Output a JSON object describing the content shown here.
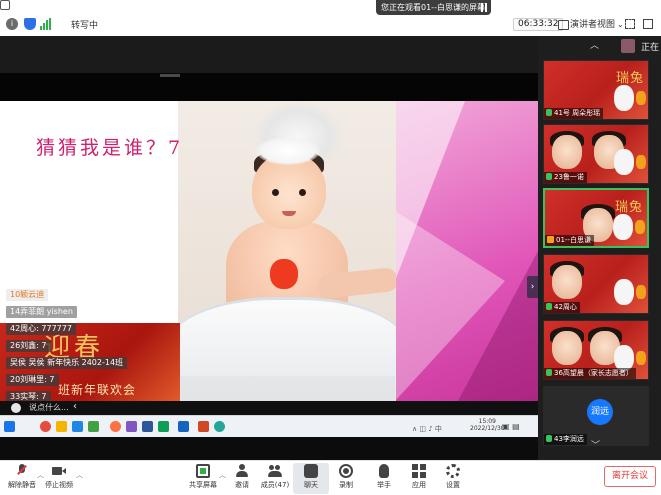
{
  "top_bar": {
    "share_notice": "您正在观看01--白思谦的屏幕",
    "transcribe_label": "转写中",
    "timer": "06:33:32",
    "speaker_view_label": "演讲者视图"
  },
  "slide": {
    "title": "猜猜我是谁？7",
    "banner_big": "迎春",
    "banner_sub": "班新年联欢会"
  },
  "comments": [
    {
      "text": "10颖云迪",
      "style": "lite"
    },
    {
      "text": "14弄菲朗 yishen",
      "style": "gray"
    },
    {
      "text": "42周心: 777777",
      "style": ""
    },
    {
      "text": "26刘鑫: 7",
      "style": ""
    },
    {
      "text": "吴侯 吴侯 新年快乐 2402-14班",
      "style": ""
    },
    {
      "text": "20刘琳里: 7",
      "style": ""
    },
    {
      "text": "33实琴: 7",
      "style": ""
    }
  ],
  "comment_input": {
    "placeholder": "说点什么..."
  },
  "taskbar": {
    "clock_time": "15:09",
    "clock_date": "2022/12/30"
  },
  "sidebar": {
    "speaking_label": "正在",
    "tiles": [
      {
        "name": "41号 周朵彤瑶",
        "badge": "mic"
      },
      {
        "name": "23鲁一诺",
        "badge": "mic"
      },
      {
        "name": "01--白思谦",
        "badge": "host"
      },
      {
        "name": "42周心",
        "badge": "mic"
      },
      {
        "name": "36高望晨（家长志愿者）",
        "badge": "mic"
      },
      {
        "name": "43李润远",
        "badge": "mic"
      }
    ],
    "avatar_text": "润远"
  },
  "controls": {
    "unmute": "解除静音",
    "stop_video": "停止视频",
    "share_screen": "共享屏幕",
    "invite": "邀请",
    "members": "成员(47)",
    "chat": "聊天",
    "record": "录制",
    "raise_hand": "举手",
    "apps": "应用",
    "settings": "设置",
    "leave": "离开会议"
  },
  "colors": {
    "accent_green": "#2db04b",
    "leave_red": "#e03a3a",
    "avatar_blue": "#1678ff",
    "slide_title_pink": "#d0206e"
  }
}
